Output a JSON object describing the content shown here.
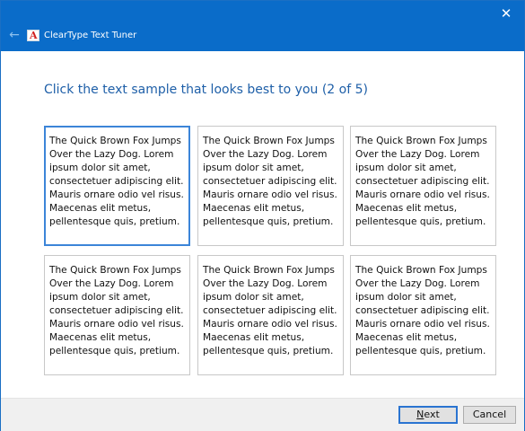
{
  "window": {
    "title": "ClearType Text Tuner",
    "close_glyph": "✕",
    "back_glyph": "←",
    "app_icon_letter": "A",
    "accent": "#0a6cc9"
  },
  "instruction": "Click the text sample that looks best to you (2 of 5)",
  "samples": [
    {
      "text": "The Quick Brown Fox Jumps\nOver the Lazy Dog. Lorem\nipsum dolor sit amet,\nconsectetuer adipiscing elit.\nMauris ornare odio vel risus.\nMaecenas elit metus,\npellentesque quis, pretium.",
      "selected": true
    },
    {
      "text": "The Quick Brown Fox Jumps\nOver the Lazy Dog. Lorem\nipsum dolor sit amet,\nconsectetuer adipiscing elit.\nMauris ornare odio vel risus.\nMaecenas elit metus,\npellentesque quis, pretium.",
      "selected": false
    },
    {
      "text": "The Quick Brown Fox Jumps\nOver the Lazy Dog. Lorem\nipsum dolor sit amet,\nconsectetuer adipiscing elit.\nMauris ornare odio vel risus.\nMaecenas elit metus,\npellentesque quis, pretium.",
      "selected": false
    },
    {
      "text": "The Quick Brown Fox Jumps\nOver the Lazy Dog. Lorem\nipsum dolor sit amet,\nconsectetuer adipiscing elit.\nMauris ornare odio vel risus.\nMaecenas elit metus,\npellentesque quis, pretium.",
      "selected": false
    },
    {
      "text": "The Quick Brown Fox Jumps\nOver the Lazy Dog. Lorem\nipsum dolor sit amet,\nconsectetuer adipiscing elit.\nMauris ornare odio vel risus.\nMaecenas elit metus,\npellentesque quis, pretium.",
      "selected": false
    },
    {
      "text": "The Quick Brown Fox Jumps\nOver the Lazy Dog. Lorem\nipsum dolor sit amet,\nconsectetuer adipiscing elit.\nMauris ornare odio vel risus.\nMaecenas elit metus,\npellentesque quis, pretium.",
      "selected": false
    }
  ],
  "buttons": {
    "next_mnemonic": "N",
    "next_rest": "ext",
    "cancel": "Cancel"
  }
}
